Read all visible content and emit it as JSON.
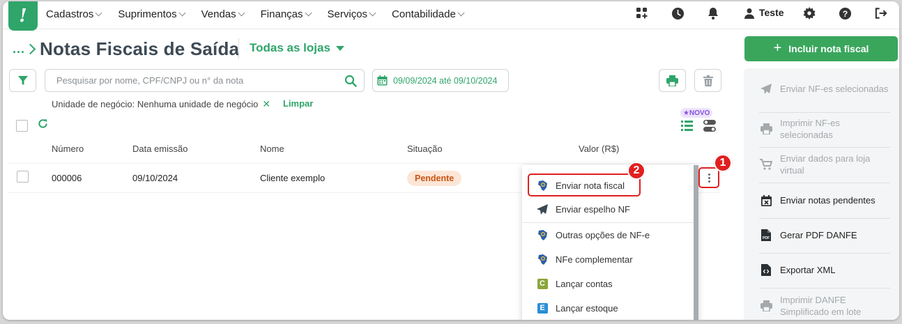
{
  "nav": {
    "menu": [
      "Cadastros",
      "Suprimentos",
      "Vendas",
      "Finanças",
      "Serviços",
      "Contabilidade"
    ],
    "user": "Teste"
  },
  "header": {
    "breadcrumb": "...",
    "title": "Notas Fiscais de Saída",
    "store": "Todas as lojas",
    "include_button": "Incluir nota fiscal"
  },
  "filters": {
    "search_placeholder": "Pesquisar por nome, CPF/CNPJ ou n° da nota",
    "date_range": "09/09/2024 até 09/10/2024",
    "active_filter": "Unidade de negócio: Nenhuma unidade de negócio",
    "clear": "Limpar"
  },
  "badges": {
    "novo": "NOVO"
  },
  "table": {
    "columns": [
      "Número",
      "Data emissão",
      "Nome",
      "Situação",
      "Valor (R$)"
    ],
    "rows": [
      {
        "numero": "000006",
        "data": "09/10/2024",
        "nome": "Cliente exemplo",
        "situacao": "Pendente",
        "valor": ""
      }
    ]
  },
  "dropdown": {
    "items": [
      {
        "label": "Enviar nota fiscal",
        "icon": "nfe-brazil-icon"
      },
      {
        "label": "Enviar espelho NF",
        "icon": "send-plane-icon"
      },
      {
        "label": "Outras opções de NF-e",
        "icon": "nfe-brazil-icon"
      },
      {
        "label": "NFe complementar",
        "icon": "nfe-brazil-icon"
      },
      {
        "label": "Lançar contas",
        "icon": "c-letter-icon"
      },
      {
        "label": "Lançar estoque",
        "icon": "e-letter-icon"
      }
    ]
  },
  "steps": [
    "1",
    "2"
  ],
  "side_actions": [
    {
      "label": "Enviar NF-es selecionadas",
      "enabled": false,
      "icon": "send-plane-icon"
    },
    {
      "label": "Imprimir NF-es selecionadas",
      "enabled": false,
      "icon": "printer-icon"
    },
    {
      "label": "Enviar dados para loja virtual",
      "enabled": false,
      "icon": "cart-icon"
    },
    {
      "label": "Enviar notas pendentes",
      "enabled": true,
      "icon": "calendar-x-icon"
    },
    {
      "label": "Gerar PDF DANFE",
      "enabled": true,
      "icon": "pdf-file-icon"
    },
    {
      "label": "Exportar XML",
      "enabled": true,
      "icon": "code-file-icon"
    },
    {
      "label": "Imprimir DANFE Simplificado em lote",
      "enabled": false,
      "icon": "printer-icon"
    }
  ],
  "colors": {
    "brand": "#2fa56a",
    "accent_button": "#3aa65c",
    "alert": "#e02020",
    "pending": "#c95412"
  }
}
